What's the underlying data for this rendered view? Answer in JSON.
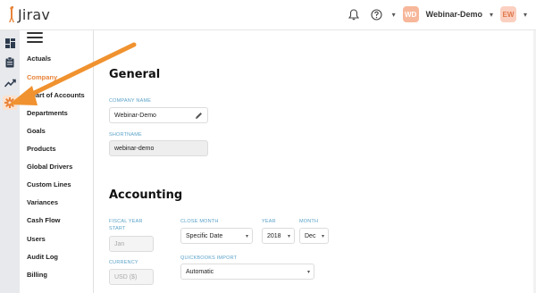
{
  "app": {
    "logo_text": "Jirav"
  },
  "header": {
    "company_initials": "WD",
    "company_name": "Webinar-Demo",
    "user_initials": "EW"
  },
  "rail": {
    "items": [
      "dashboard-icon",
      "clipboard-icon",
      "trend-icon",
      "gear-icon"
    ],
    "active": "gear-icon"
  },
  "nav": {
    "items": [
      {
        "label": "Actuals"
      },
      {
        "label": "Company",
        "active": true
      },
      {
        "label": "Chart of Accounts"
      },
      {
        "label": "Departments"
      },
      {
        "label": "Goals"
      },
      {
        "label": "Products"
      },
      {
        "label": "Global Drivers"
      },
      {
        "label": "Custom Lines"
      },
      {
        "label": "Variances"
      },
      {
        "label": "Cash Flow"
      },
      {
        "label": "Users"
      },
      {
        "label": "Audit Log"
      },
      {
        "label": "Billing"
      }
    ]
  },
  "general": {
    "title": "General",
    "company_name_label": "COMPANY NAME",
    "company_name_value": "Webinar-Demo",
    "shortname_label": "SHORTNAME",
    "shortname_value": "webinar-demo"
  },
  "accounting": {
    "title": "Accounting",
    "fiscal_label": "FISCAL YEAR START",
    "fiscal_value": "Jan",
    "close_month_label": "CLOSE MONTH",
    "close_month_value": "Specific Date",
    "year_label": "YEAR",
    "year_value": "2018",
    "month_label": "MONTH",
    "month_value": "Dec",
    "currency_label": "CURRENCY",
    "currency_value": "USD ($)",
    "qb_label": "QUICKBOOKS IMPORT",
    "qb_value": "Automatic"
  },
  "colors": {
    "accent": "#e8843a",
    "label_blue": "#5aa2c8",
    "arrow": "#f0922f"
  }
}
